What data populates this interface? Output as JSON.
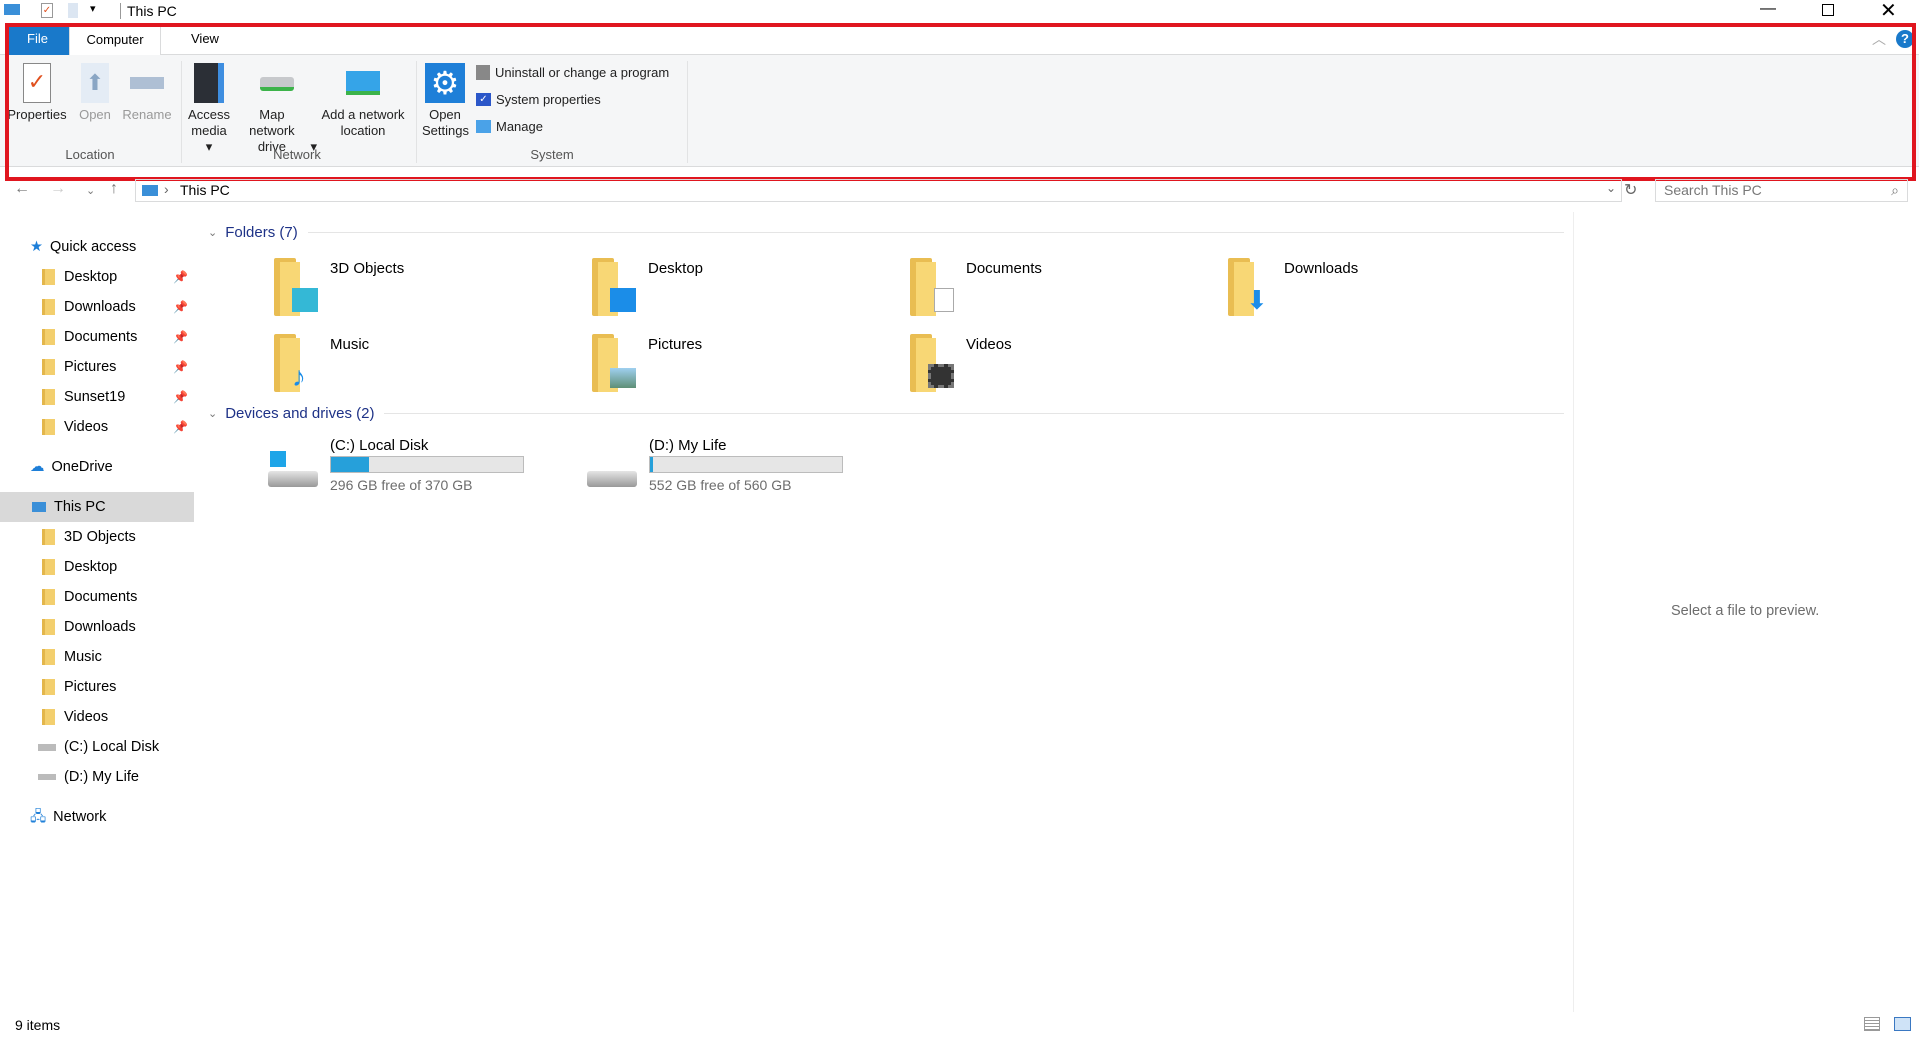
{
  "window": {
    "title": "This PC"
  },
  "ribbon": {
    "tabs": [
      "File",
      "Computer",
      "View"
    ],
    "location": {
      "label": "Location",
      "properties": "Properties",
      "open": "Open",
      "rename": "Rename"
    },
    "network": {
      "label": "Network",
      "access_media": "Access media",
      "map_drive": "Map network drive",
      "add_location": "Add a network location"
    },
    "system": {
      "label": "System",
      "open_settings": "Open Settings",
      "uninstall": "Uninstall or change a program",
      "system_properties": "System properties",
      "manage": "Manage"
    }
  },
  "address": {
    "path": "This PC",
    "search_placeholder": "Search This PC"
  },
  "sidebar": {
    "quick_access": "Quick access",
    "quick_items": [
      "Desktop",
      "Downloads",
      "Documents",
      "Pictures",
      "Sunset19",
      "Videos"
    ],
    "onedrive": "OneDrive",
    "this_pc": "This PC",
    "pc_items": [
      "3D Objects",
      "Desktop",
      "Documents",
      "Downloads",
      "Music",
      "Pictures",
      "Videos",
      "(C:) Local Disk",
      "(D:) My Life"
    ],
    "network": "Network"
  },
  "content": {
    "folders_header": "Folders (7)",
    "folders": [
      "3D Objects",
      "Desktop",
      "Documents",
      "Downloads",
      "Music",
      "Pictures",
      "Videos"
    ],
    "drives_header": "Devices and drives (2)",
    "drives": [
      {
        "name": "(C:) Local Disk",
        "free": "296 GB free of 370 GB",
        "used_fraction": 0.2
      },
      {
        "name": "(D:) My Life",
        "free": "552 GB free of 560 GB",
        "used_fraction": 0.014
      }
    ]
  },
  "preview": {
    "text": "Select a file to preview."
  },
  "status": {
    "items": "9 items"
  },
  "colors": {
    "accent": "#1979ca",
    "highlight": "#e0161f",
    "drive_bar": "#26a0da"
  }
}
